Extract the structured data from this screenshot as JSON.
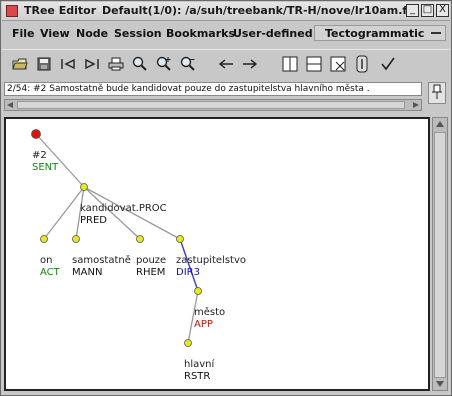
{
  "window": {
    "app_title": "TRee Editor",
    "file_title": "Default(1/0): /a/suh/treebank/TR-H/nove/lr10am.fs",
    "minimize": "_",
    "maximize": "□",
    "close": "X"
  },
  "menu": {
    "items": [
      "File",
      "View",
      "Node",
      "Session",
      "Bookmarks",
      "User-defined"
    ],
    "mode": "Tectogrammatic"
  },
  "toolbar": {
    "icons": [
      "open-icon",
      "save-icon",
      "first-tree-icon",
      "last-tree-icon",
      "print-icon",
      "zoom-icon",
      "zoom-in-icon",
      "zoom-out-icon",
      "previous-arrow-icon",
      "next-arrow-icon",
      "split-vertical-icon",
      "split-horizontal-icon",
      "close-view-icon",
      "fit-icon",
      "check-icon"
    ]
  },
  "sentence": {
    "text": "2/54: #2 Samostatně bude kandidovat pouze do zastupitelstva hlavního města ."
  },
  "tree": {
    "nodes": [
      {
        "id": "root",
        "label": "#2",
        "func": "SENT",
        "color": "#dd1111",
        "func_color": "#118811"
      },
      {
        "id": "pred",
        "label": "kandidovat.PROC",
        "func": "PRED",
        "color": "#e8e81a",
        "func_color": "#111111"
      },
      {
        "id": "on",
        "label": "on",
        "func": "ACT",
        "color": "#e8e81a",
        "func_color": "#118811"
      },
      {
        "id": "samostatne",
        "label": "samostatně",
        "func": "MANN",
        "color": "#e8e81a",
        "func_color": "#111111"
      },
      {
        "id": "pouze",
        "label": "pouze",
        "func": "RHEM",
        "color": "#e8e81a",
        "func_color": "#111111"
      },
      {
        "id": "zastupitelstvo",
        "label": "zastupitelstvo",
        "func": "DIR3",
        "color": "#e8e81a",
        "func_color": "#1111cc"
      },
      {
        "id": "mesto",
        "label": "město",
        "func": "APP",
        "color": "#e8e81a",
        "func_color": "#cc1111"
      },
      {
        "id": "hlavni",
        "label": "hlavní",
        "func": "RSTR",
        "color": "#e8e81a",
        "func_color": "#111111"
      }
    ],
    "edges": [
      [
        "root",
        "pred"
      ],
      [
        "pred",
        "on"
      ],
      [
        "pred",
        "samostatne"
      ],
      [
        "pred",
        "pouze"
      ],
      [
        "pred",
        "zastupitelstvo"
      ],
      [
        "zastupitelstvo",
        "mesto"
      ],
      [
        "mesto",
        "hlavni"
      ]
    ],
    "edge_colors": {
      "default": "#999999",
      "dir3_link": "#4444cc"
    }
  }
}
